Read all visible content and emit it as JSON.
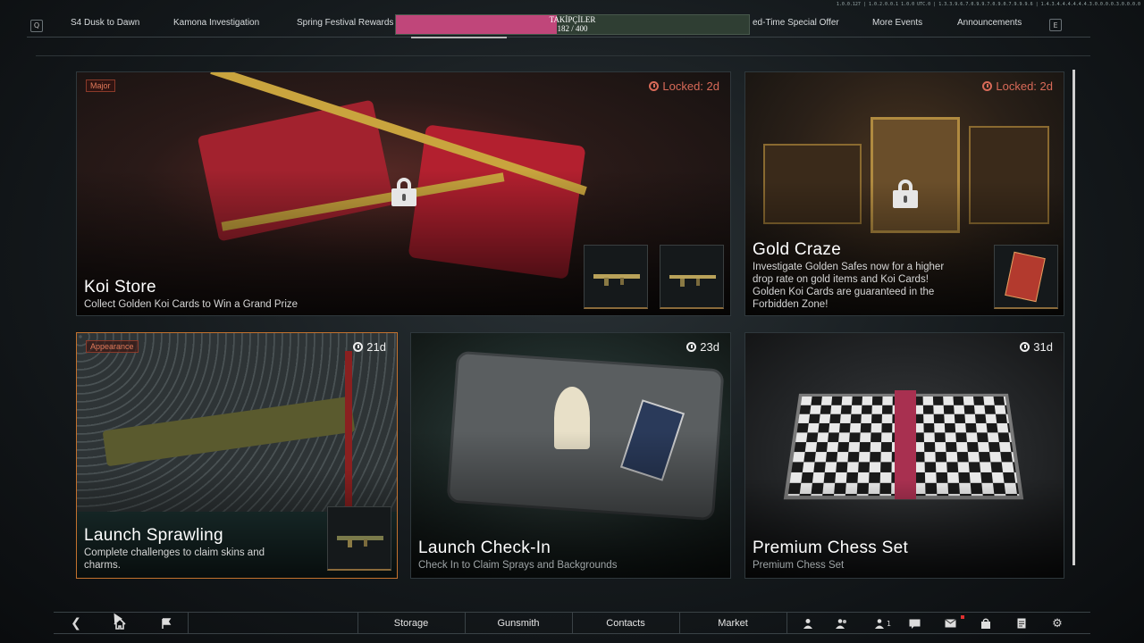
{
  "top_tiny": "1.0.0.127 | 1.0.2.0.0.1 1.0.0 UTC.0 | 1.3.3.9.6.7.0.9.9.7.0.9.0.7.9.9.9.6 | 1.4.3.4.4.4.4.4.4.3.0.0.0.0.3.0.0.0.0",
  "nav": {
    "left_key": "Q",
    "right_key": "E",
    "tabs": [
      {
        "label": "S4 Dusk to Dawn"
      },
      {
        "label": "Kamona Investigation"
      },
      {
        "label": "Spring Festival Rewards"
      },
      {
        "label": "ed-Time Special Offer"
      },
      {
        "label": "More Events"
      },
      {
        "label": "Announcements"
      }
    ]
  },
  "followers": {
    "title": "TAKİPÇİLER",
    "current": 182,
    "goal": 400,
    "count_text": "182 / 400",
    "fill_color": "#c0467a"
  },
  "cards": {
    "koi": {
      "tag": "Major",
      "timer": "Locked: 2d",
      "title": "Koi Store",
      "desc": "Collect Golden Koi Cards to Win a Grand Prize"
    },
    "gold": {
      "timer": "Locked: 2d",
      "title": "Gold Craze",
      "desc_lines": [
        "Investigate Golden Safes now for a higher",
        "drop rate on gold items and Koi Cards!",
        "Golden Koi Cards are guaranteed in the",
        "Forbidden Zone!"
      ]
    },
    "sprawling": {
      "tag": "Appearance",
      "timer": "21d",
      "title": "Launch Sprawling",
      "desc_lines": [
        "Complete challenges to claim skins and",
        "charms."
      ]
    },
    "checkin": {
      "timer": "23d",
      "title": "Launch Check-In",
      "desc": "Check In to Claim Sprays and Backgrounds"
    },
    "chess": {
      "timer": "31d",
      "title": "Premium Chess Set",
      "desc": "Premium Chess Set"
    }
  },
  "bottom": {
    "storage": "Storage",
    "gunsmith": "Gunsmith",
    "contacts": "Contacts",
    "market": "Market",
    "party_count": "1"
  },
  "colors": {
    "locked": "#d86a58",
    "tag_text": "#e0795a",
    "selected_border": "#c4722e"
  }
}
